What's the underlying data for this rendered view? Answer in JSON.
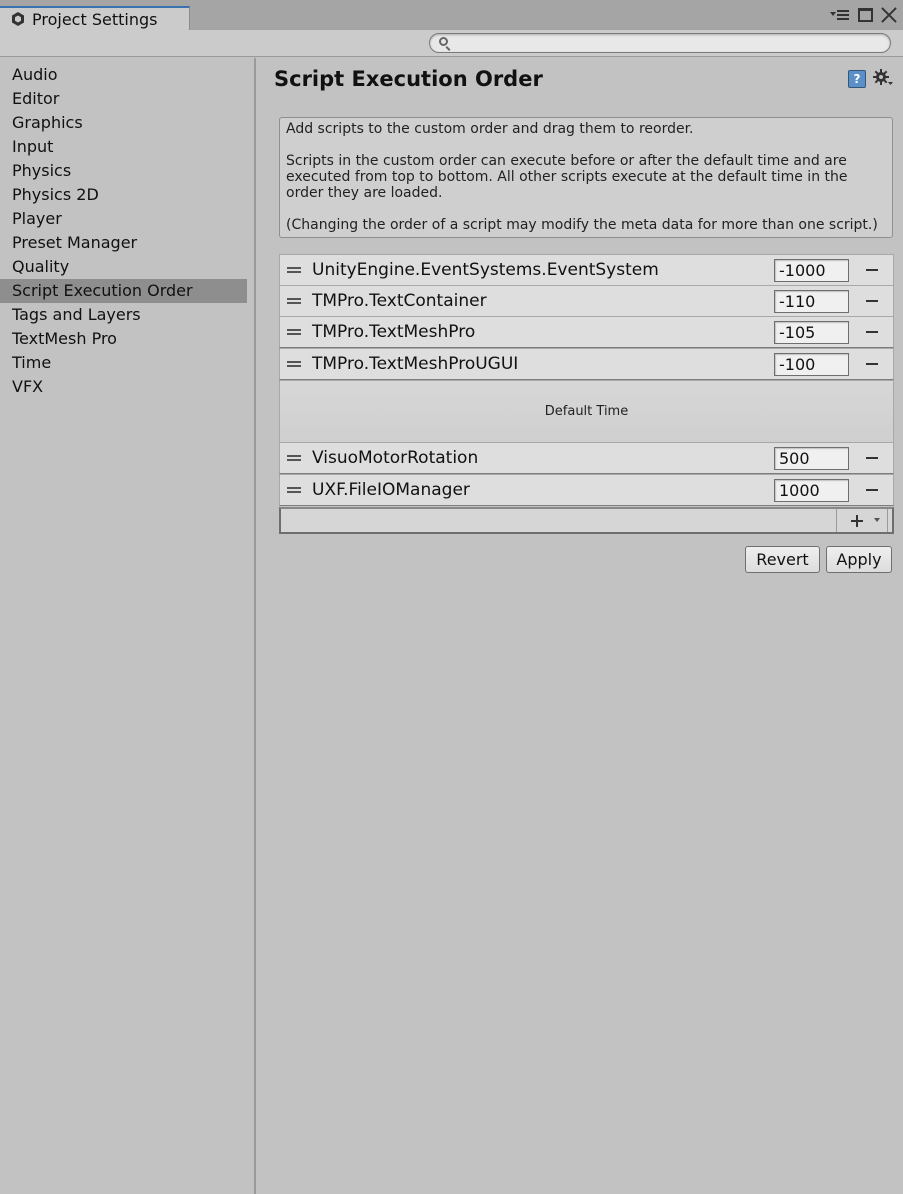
{
  "window": {
    "tab_title": "Project Settings",
    "icons": [
      "unity-logo-icon",
      "menu-icon",
      "maximize-icon",
      "close-icon"
    ]
  },
  "search": {
    "placeholder": "",
    "value": ""
  },
  "sidebar": {
    "selected": "Script Execution Order",
    "items": [
      {
        "label": "Audio"
      },
      {
        "label": "Editor"
      },
      {
        "label": "Graphics"
      },
      {
        "label": "Input"
      },
      {
        "label": "Physics"
      },
      {
        "label": "Physics 2D"
      },
      {
        "label": "Player"
      },
      {
        "label": "Preset Manager"
      },
      {
        "label": "Quality"
      },
      {
        "label": "Script Execution Order"
      },
      {
        "label": "Tags and Layers"
      },
      {
        "label": "TextMesh Pro"
      },
      {
        "label": "Time"
      },
      {
        "label": "VFX"
      }
    ]
  },
  "main": {
    "title": "Script Execution Order",
    "help_icon_glyph": "?",
    "info": {
      "line1": "Add scripts to the custom order and drag them to reorder.",
      "line2": "Scripts in the custom order can execute before or after the default time and are executed from top to bottom. All other scripts execute at the default time in the order they are loaded.",
      "line3": "(Changing the order of a script may modify the meta data for more than one script.)"
    },
    "scripts_before": [
      {
        "name": "UnityEngine.EventSystems.EventSystem",
        "order": "-1000"
      },
      {
        "name": "TMPro.TextContainer",
        "order": "-110"
      },
      {
        "name": "TMPro.TextMeshPro",
        "order": "-105"
      },
      {
        "name": "TMPro.TextMeshProUGUI",
        "order": "-100"
      }
    ],
    "default_time_label": "Default Time",
    "scripts_after": [
      {
        "name": "VisuoMotorRotation",
        "order": "500"
      },
      {
        "name": "UXF.FileIOManager",
        "order": "1000"
      }
    ],
    "buttons": {
      "revert": "Revert",
      "apply": "Apply"
    }
  },
  "colors": {
    "background": "#c2c2c2",
    "selected_item": "#8e8e8e",
    "tab_accent": "#3a72b0",
    "row_background": "#dedede"
  }
}
